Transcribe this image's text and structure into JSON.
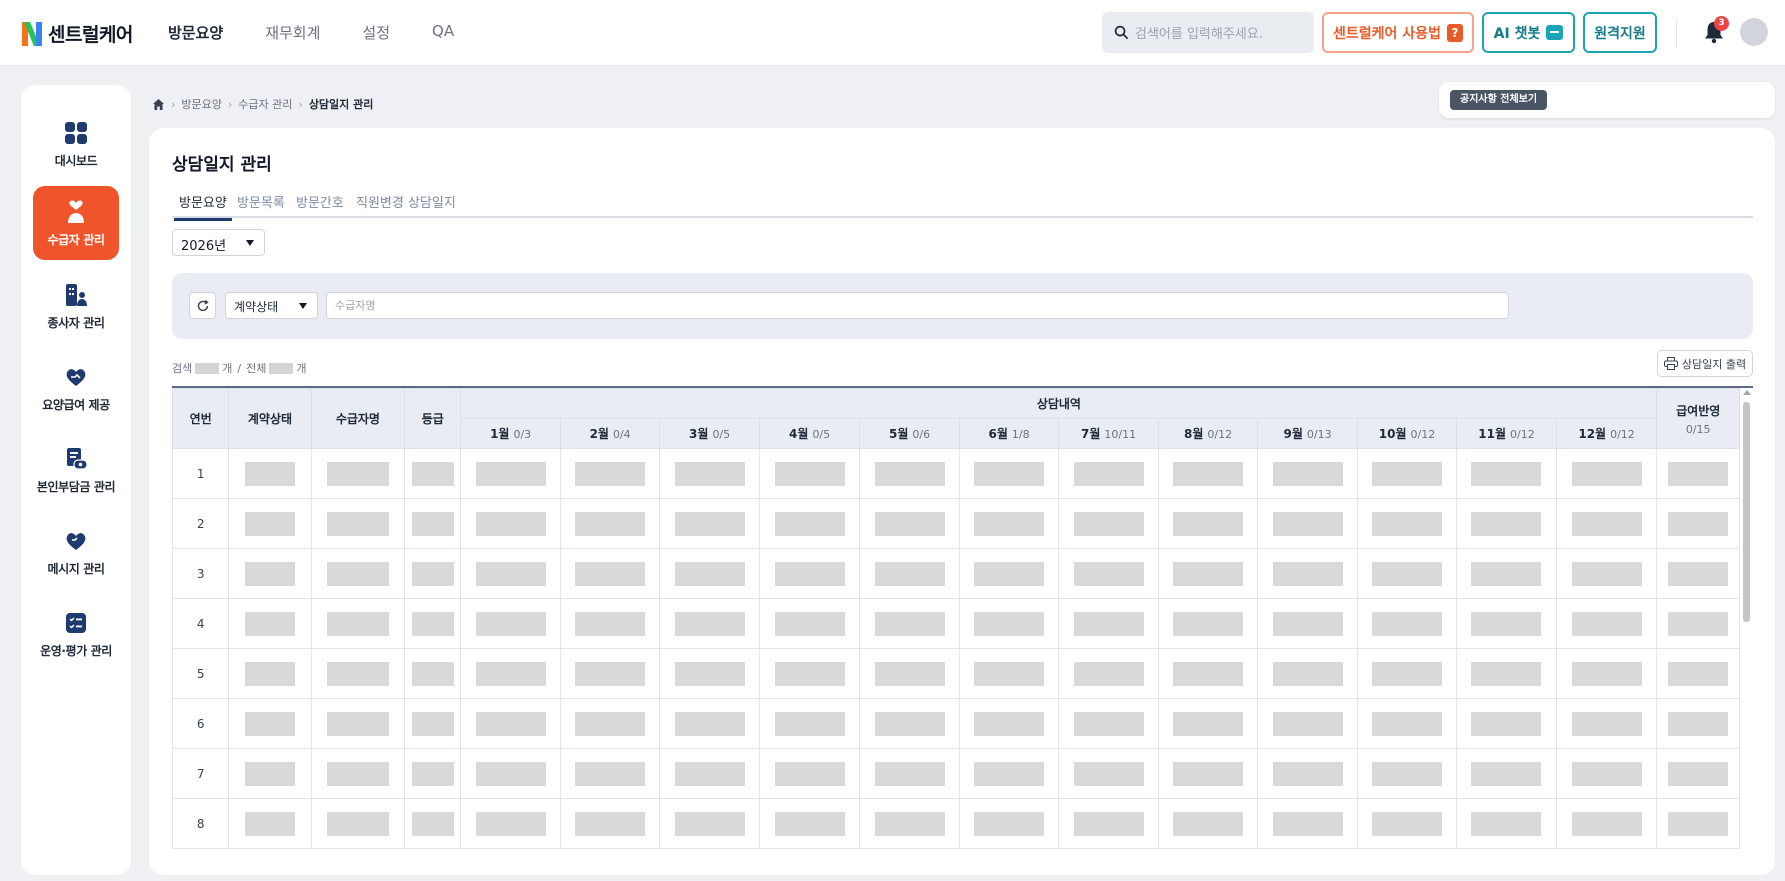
{
  "header": {
    "logo_text": "센트럴케어",
    "nav": [
      "방문요양",
      "재무회계",
      "설정",
      "QA"
    ],
    "search_placeholder": "검색어를 입력해주세요.",
    "guide_label": "센트럴케어 사용법",
    "ai_label": "AI 챗봇",
    "remote_label": "원격지원",
    "notification_count": "3"
  },
  "sidebar": {
    "items": [
      {
        "label": "대시보드",
        "icon": "dashboard-icon"
      },
      {
        "label": "수급자 관리",
        "icon": "heart-user-icon",
        "active": true
      },
      {
        "label": "종사자 관리",
        "icon": "staff-icon"
      },
      {
        "label": "요양급여 제공",
        "icon": "heart-hand-icon"
      },
      {
        "label": "본인부담금 관리",
        "icon": "wallet-icon"
      },
      {
        "label": "메시지 관리",
        "icon": "message-heart-icon"
      },
      {
        "label": "운영·평가 관리",
        "icon": "checklist-icon"
      }
    ]
  },
  "breadcrumb": [
    "방문요양",
    "수급자 관리",
    "상담일지 관리"
  ],
  "notice_button": "공지사항 전체보기",
  "page": {
    "title": "상담일지 관리",
    "tabs": [
      "방문요양",
      "방문목록",
      "방문간호",
      "직원변경 상담일지"
    ],
    "year": "2026년",
    "filter": {
      "status_label": "계약상태",
      "name_placeholder": "수급자명"
    },
    "count": {
      "search_prefix": "검색",
      "unit": "개",
      "separator": "/",
      "total_prefix": "전체"
    },
    "print_label": "상담일지 출력"
  },
  "table": {
    "headers": {
      "no": "연번",
      "status": "계약상태",
      "name": "수급자명",
      "grade": "등급",
      "group": "상담내역",
      "reflect": "급여반영",
      "reflect_count": "0/15"
    },
    "months": [
      {
        "m": "1월",
        "c": "0/3"
      },
      {
        "m": "2월",
        "c": "0/4"
      },
      {
        "m": "3월",
        "c": "0/5"
      },
      {
        "m": "4월",
        "c": "0/5"
      },
      {
        "m": "5월",
        "c": "0/6"
      },
      {
        "m": "6월",
        "c": "1/8"
      },
      {
        "m": "7월",
        "c": "10/11"
      },
      {
        "m": "8월",
        "c": "0/12"
      },
      {
        "m": "9월",
        "c": "0/13"
      },
      {
        "m": "10월",
        "c": "0/12"
      },
      {
        "m": "11월",
        "c": "0/12"
      },
      {
        "m": "12월",
        "c": "0/12"
      }
    ],
    "rows": [
      "1",
      "2",
      "3",
      "4",
      "5",
      "6",
      "7",
      "8"
    ]
  }
}
